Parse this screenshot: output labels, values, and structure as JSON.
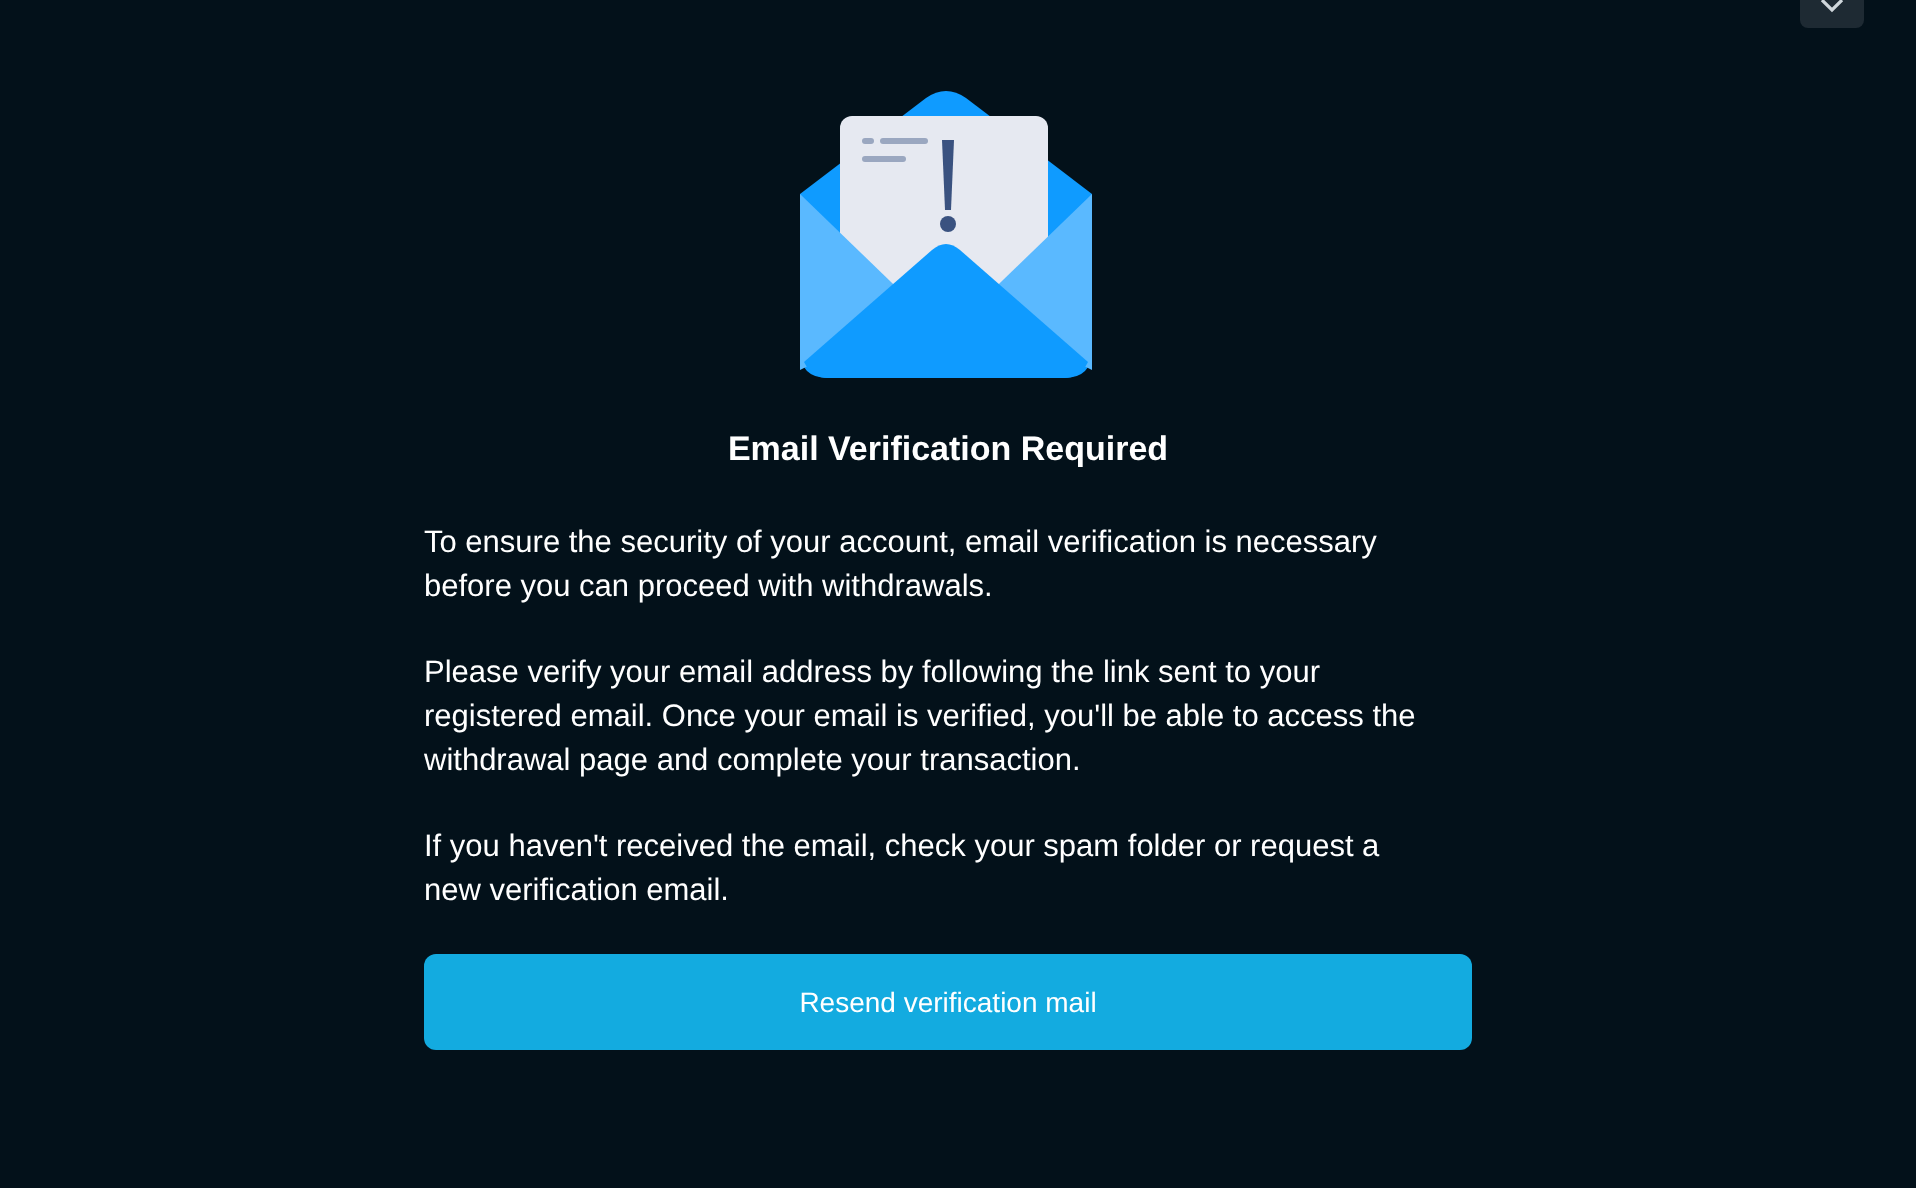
{
  "modal": {
    "title": "Email Verification Required",
    "paragraphs": [
      "To ensure the security of your account, email verification is necessary before you can proceed with withdrawals.",
      "Please verify your email address by following the link sent to your registered email. Once your email is verified, you'll be able to access the withdrawal page and complete your transaction.",
      "If you haven't received the email, check your spam folder or request a new verification email."
    ],
    "button": "Resend verification mail"
  }
}
